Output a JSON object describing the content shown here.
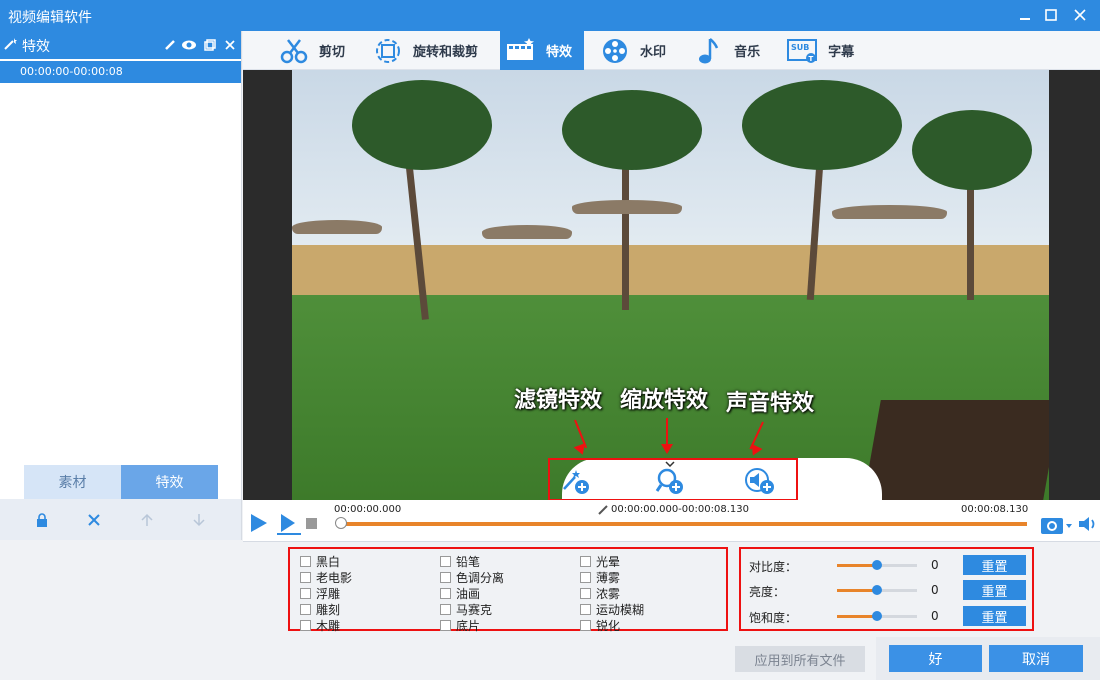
{
  "window": {
    "title": "视频编辑软件"
  },
  "left_panel": {
    "header_label": "特效",
    "clip_item": "00:00:00-00:00:08",
    "tabs": [
      {
        "label": "素材"
      },
      {
        "label": "特效"
      }
    ]
  },
  "top_tabs": [
    {
      "label": "剪切",
      "icon": "scissors-icon"
    },
    {
      "label": "旋转和裁剪",
      "icon": "crop-rotate-icon"
    },
    {
      "label": "特效",
      "icon": "film-sparkle-icon",
      "active": true
    },
    {
      "label": "水印",
      "icon": "film-reel-icon"
    },
    {
      "label": "音乐",
      "icon": "music-note-icon"
    },
    {
      "label": "字幕",
      "icon": "subtitle-icon"
    }
  ],
  "video": {
    "annotations": {
      "filter": "滤镜特效",
      "zoom": "缩放特效",
      "audio": "声音特效"
    }
  },
  "timeline": {
    "start": "00:00:00.000",
    "range": "00:00:00.000-00:00:08.130",
    "end": "00:00:08.130"
  },
  "filters": {
    "col1": [
      "黑白",
      "老电影",
      "浮雕",
      "雕刻",
      "木雕"
    ],
    "col2": [
      "铅笔",
      "色调分离",
      "油画",
      "马赛克",
      "底片"
    ],
    "col3": [
      "光晕",
      "薄雾",
      "浓雾",
      "运动模糊",
      "锐化"
    ]
  },
  "adjustments": [
    {
      "label": "对比度：",
      "value": "0",
      "level": 0.5,
      "reset": "重置"
    },
    {
      "label": "亮度：",
      "value": "0",
      "level": 0.5,
      "reset": "重置"
    },
    {
      "label": "饱和度：",
      "value": "0",
      "level": 0.5,
      "reset": "重置"
    }
  ],
  "footer": {
    "apply_all": "应用到所有文件",
    "ok": "好",
    "cancel": "取消"
  },
  "colors": {
    "accent": "#2e8ae0",
    "progress": "#e8842a",
    "highlight_box": "#e11111"
  }
}
